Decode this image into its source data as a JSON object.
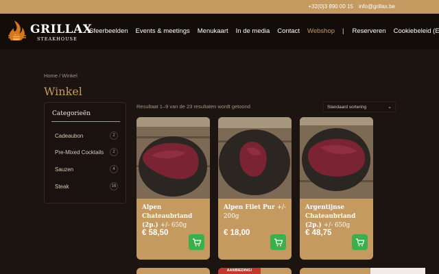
{
  "topbar": {
    "phone": "+32(0)3 890 00 15",
    "email": "info@grillax.be"
  },
  "logo": {
    "name": "GRILLAX",
    "sub": "STEAKHOUSE"
  },
  "nav": [
    {
      "label": "Sfeerbeelden",
      "active": false
    },
    {
      "label": "Events & meetings",
      "active": false
    },
    {
      "label": "Menukaart",
      "active": false
    },
    {
      "label": "In de media",
      "active": false
    },
    {
      "label": "Contact",
      "active": false
    },
    {
      "label": "Webshop",
      "active": true
    }
  ],
  "nav_separator": "|",
  "nav_right": [
    {
      "label": "Reserveren"
    },
    {
      "label": "Cookiebeleid (EU)"
    }
  ],
  "breadcrumb": "Home / Winkel",
  "page_title": "Winkel",
  "categories": {
    "heading": "Categorieën",
    "items": [
      {
        "label": "Cadeaubon",
        "count": "2"
      },
      {
        "label": "Pre-Mixed Cocktails",
        "count": "2"
      },
      {
        "label": "Sauzen",
        "count": "4"
      },
      {
        "label": "Steak",
        "count": "16"
      }
    ]
  },
  "result_count": "Resultaat 1–9 van de 23 resultaten wordt getoond",
  "sort": {
    "selected": "Standaard sortering",
    "chevron": "⌄"
  },
  "products": [
    {
      "title": "Alpen Chateaubriand (2p.)",
      "weight": "+/- 650g",
      "price": "€ 58,50"
    },
    {
      "title": "Alpen Filet Pur",
      "weight": "+/- 200g",
      "price": "€ 18,00"
    },
    {
      "title": "Argentijnse Chateaubriand (2p.)",
      "weight": "+/- 650g",
      "price": "€ 48,75"
    }
  ],
  "row2_ribbon": "AANBIEDING!",
  "colors": {
    "accent": "#c49a60",
    "background": "#1c1410",
    "cart": "#3cae4b"
  }
}
